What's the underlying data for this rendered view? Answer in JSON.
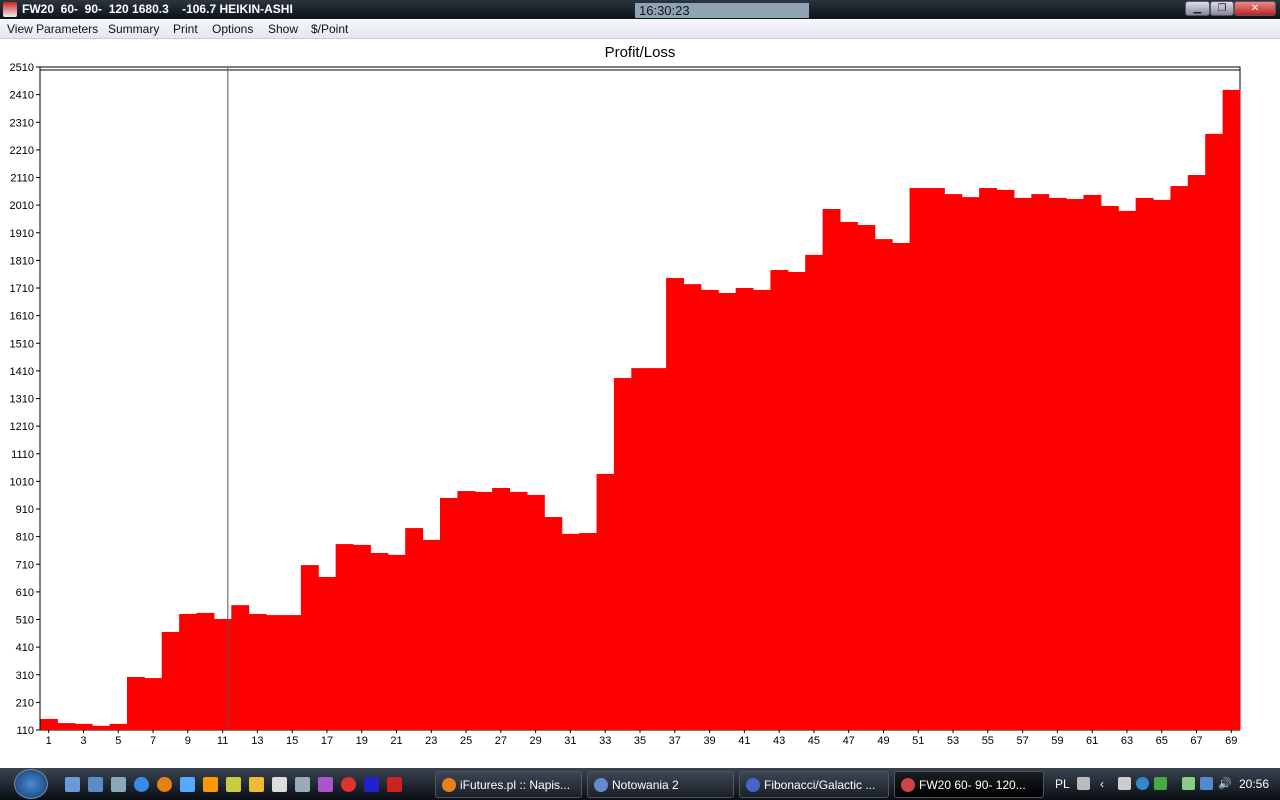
{
  "window": {
    "title": "FW20  60-  90-  120 1680.3    -106.7 HEIKIN-ASHI",
    "clock": "16:30:23",
    "minimize": "▁",
    "restore": "❐",
    "close": "✕"
  },
  "menu": [
    "View Parameters",
    "Summary",
    "Print",
    "Options",
    "Show",
    "$/Point"
  ],
  "chart_data": {
    "type": "bar",
    "title": "Profit/Loss",
    "xlabel": "",
    "ylabel": "",
    "ylim": [
      110,
      2510
    ],
    "yticks": [
      110,
      210,
      310,
      410,
      510,
      610,
      710,
      810,
      910,
      1010,
      1110,
      1210,
      1310,
      1410,
      1510,
      1610,
      1710,
      1810,
      1910,
      2010,
      2110,
      2210,
      2310,
      2410,
      2510
    ],
    "xticks": [
      1,
      3,
      5,
      7,
      9,
      11,
      13,
      15,
      17,
      19,
      21,
      23,
      25,
      27,
      29,
      31,
      33,
      35,
      37,
      39,
      41,
      43,
      45,
      47,
      49,
      51,
      53,
      55,
      57,
      59,
      61,
      63,
      65,
      67,
      69
    ],
    "categories": [
      1,
      2,
      3,
      4,
      5,
      6,
      7,
      8,
      9,
      10,
      11,
      12,
      13,
      14,
      15,
      16,
      17,
      18,
      19,
      20,
      21,
      22,
      23,
      24,
      25,
      26,
      27,
      28,
      29,
      30,
      31,
      32,
      33,
      34,
      35,
      36,
      37,
      38,
      39,
      40,
      41,
      42,
      43,
      44,
      45,
      46,
      47,
      48,
      49,
      50,
      51,
      52,
      53,
      54,
      55,
      56,
      57,
      58,
      59,
      60,
      61,
      62,
      63,
      64,
      65,
      66,
      67,
      68,
      69
    ],
    "values": [
      150,
      135,
      132,
      125,
      132,
      302,
      298,
      465,
      530,
      534,
      512,
      562,
      530,
      526,
      526,
      707,
      664,
      783,
      780,
      751,
      744,
      841,
      798,
      950,
      975,
      972,
      986,
      972,
      961,
      881,
      820,
      823,
      1037,
      1384,
      1420,
      1420,
      1746,
      1724,
      1703,
      1692,
      1710,
      1703,
      1775,
      1768,
      1830,
      1996,
      1949,
      1938,
      1887,
      1873,
      2072,
      2072,
      2050,
      2039,
      2072,
      2065,
      2036,
      2050,
      2036,
      2032,
      2047,
      2007,
      1989,
      2036,
      2029,
      2079,
      2119,
      2268,
      2427
    ],
    "cursor_x": 10.8,
    "bar_color": "#ff0000"
  },
  "taskbar": {
    "tasks": [
      "iFutures.pl :: Napis...",
      "Notowania 2",
      "Fibonacci/Galactic ...",
      "FW20  60-  90-  120..."
    ],
    "lang": "PL",
    "time": "20:56"
  }
}
